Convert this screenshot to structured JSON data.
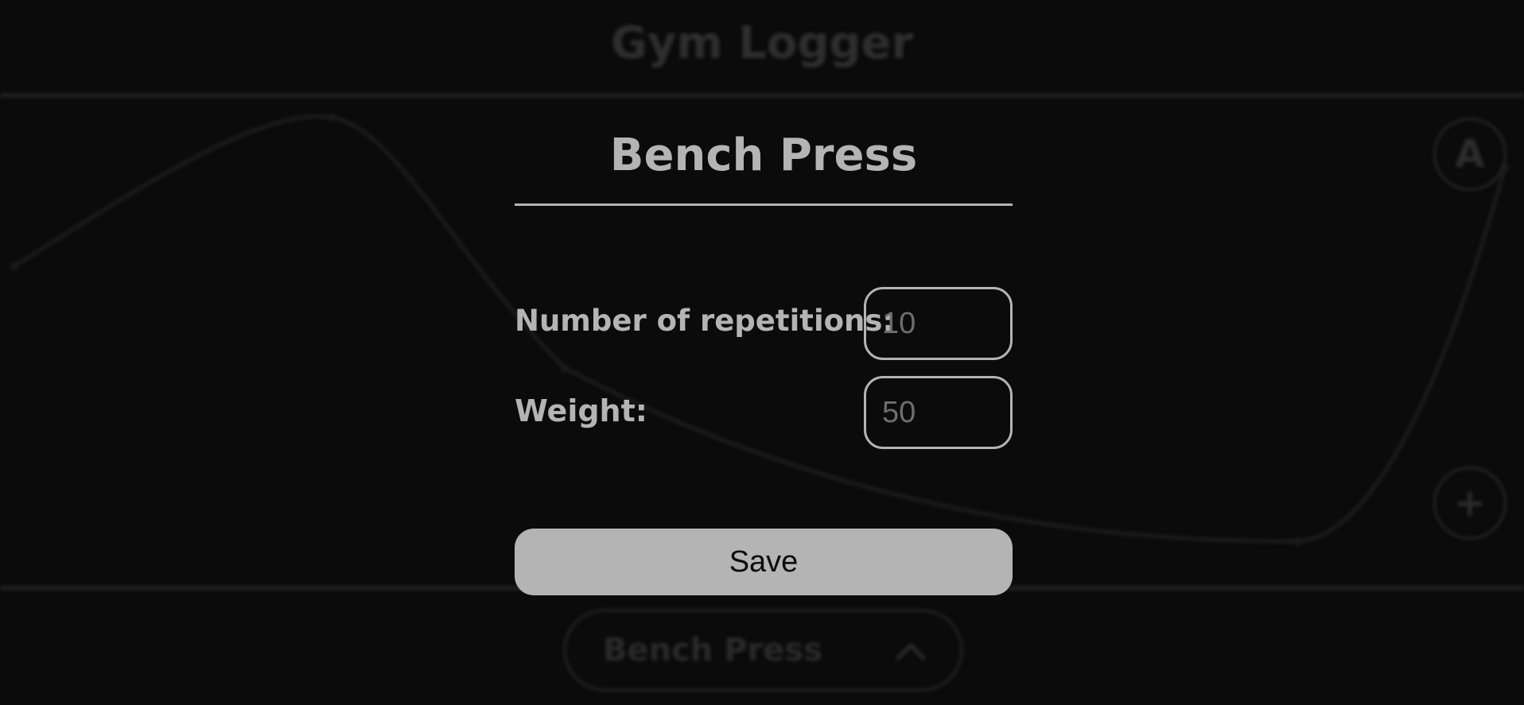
{
  "app": {
    "title": "Gym Logger",
    "auto_button_label": "A",
    "add_button_label": "+"
  },
  "exercise_select": {
    "selected": "Bench Press"
  },
  "modal": {
    "title": "Bench Press",
    "reps_label": "Number of repetitions:",
    "reps_placeholder": "10",
    "weight_label": "Weight:",
    "weight_placeholder": "50",
    "save_label": "Save"
  },
  "colors": {
    "background": "#0b0b0b",
    "modal_text": "#b4b4b4",
    "save_button_bg": "#b4b4b4",
    "dimmed_elements": "#262626"
  }
}
